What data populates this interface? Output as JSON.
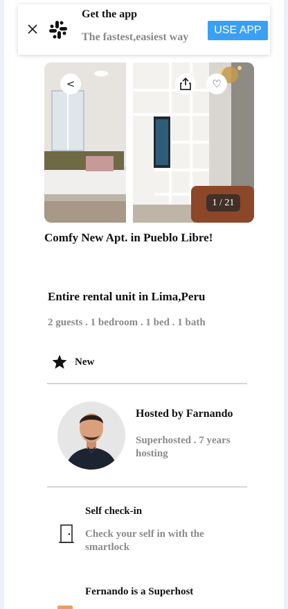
{
  "banner": {
    "title": "Get the app",
    "subtitle": "The fastest,easiest way",
    "button_label": "USE APP",
    "accent_color": "#3aa0f3",
    "logo_icon": "slack-icon",
    "close_icon": "close-icon"
  },
  "gallery": {
    "counter": "1 / 21",
    "back_label": "<",
    "share_icon": "share-icon",
    "favorite_label": "♡"
  },
  "listing": {
    "title": "Comfy New Apt. in Pueblo Libre!",
    "unit_title": "Entire rental unit in Lima,Peru",
    "details": "2 guests . 1 bedroom . 1 bed . 1 bath",
    "badge_label": "New",
    "badge_icon": "star-icon"
  },
  "host": {
    "name": "Hosted by Farnando",
    "info": "Superhosted . 7 years hosting",
    "avatar_icon": "host-avatar"
  },
  "highlights": [
    {
      "icon": "door-icon",
      "title": "Self check-in",
      "description": "Check your self in with the smartlock"
    },
    {
      "icon": "medal-icon",
      "title": "Fernando is a Superhost",
      "description": ""
    }
  ]
}
